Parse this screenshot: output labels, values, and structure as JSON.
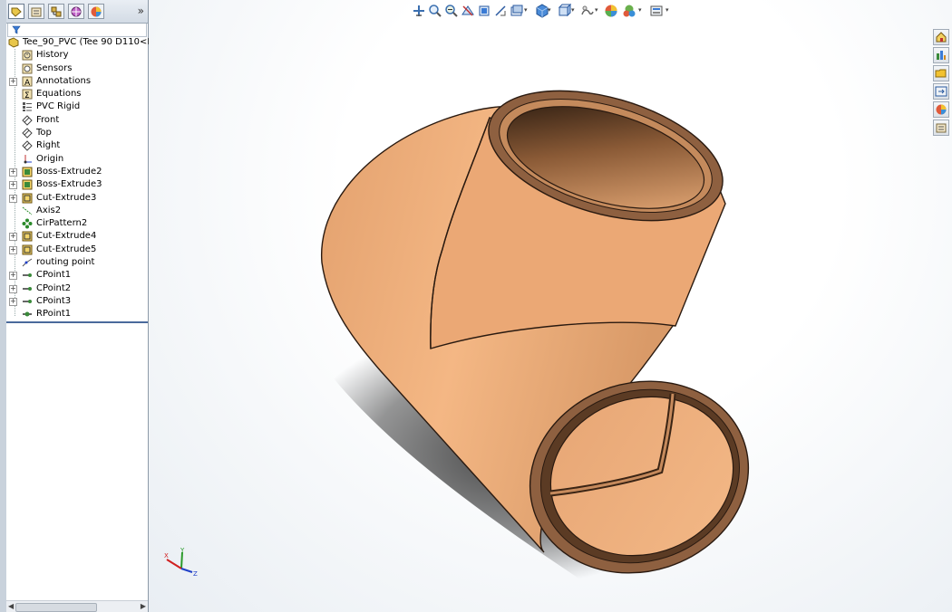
{
  "panel": {
    "tabs": [
      "feature-manager",
      "property-manager",
      "configuration-manager",
      "dim-xpert-manager",
      "display-manager"
    ],
    "expand_label": "»"
  },
  "tree": {
    "root": "Tee_90_PVC  (Tee 90 D110<D",
    "items": [
      {
        "label": "History",
        "icon": "history-icon",
        "expandable": false
      },
      {
        "label": "Sensors",
        "icon": "sensors-icon",
        "expandable": false
      },
      {
        "label": "Annotations",
        "icon": "annotations-icon",
        "expandable": true
      },
      {
        "label": "Equations",
        "icon": "equations-icon",
        "expandable": false
      },
      {
        "label": "PVC Rigid",
        "icon": "material-icon",
        "expandable": false
      },
      {
        "label": "Front",
        "icon": "plane-icon",
        "expandable": false
      },
      {
        "label": "Top",
        "icon": "plane-icon",
        "expandable": false
      },
      {
        "label": "Right",
        "icon": "plane-icon",
        "expandable": false
      },
      {
        "label": "Origin",
        "icon": "origin-icon",
        "expandable": false
      },
      {
        "label": "Boss-Extrude2",
        "icon": "boss-extrude-icon",
        "expandable": true
      },
      {
        "label": "Boss-Extrude3",
        "icon": "boss-extrude-icon",
        "expandable": true
      },
      {
        "label": "Cut-Extrude3",
        "icon": "cut-extrude-icon",
        "expandable": true
      },
      {
        "label": "Axis2",
        "icon": "axis-icon",
        "expandable": false
      },
      {
        "label": "CirPattern2",
        "icon": "circular-pattern-icon",
        "expandable": false
      },
      {
        "label": "Cut-Extrude4",
        "icon": "cut-extrude-icon",
        "expandable": true
      },
      {
        "label": "Cut-Extrude5",
        "icon": "cut-extrude-icon",
        "expandable": true
      },
      {
        "label": "routing point",
        "icon": "routing-point-icon",
        "expandable": false
      },
      {
        "label": "CPoint1",
        "icon": "connection-point-icon",
        "expandable": true
      },
      {
        "label": "CPoint2",
        "icon": "connection-point-icon",
        "expandable": true
      },
      {
        "label": "CPoint3",
        "icon": "connection-point-icon",
        "expandable": true
      },
      {
        "label": "RPoint1",
        "icon": "route-point-icon",
        "expandable": false
      }
    ]
  },
  "triad": {
    "x": "X",
    "y": "Y",
    "z": "Z"
  },
  "colors": {
    "part": "#e8aa78",
    "part_dark": "#5a3a22",
    "background": "#ffffff",
    "panel_border": "#8d9aa8"
  }
}
